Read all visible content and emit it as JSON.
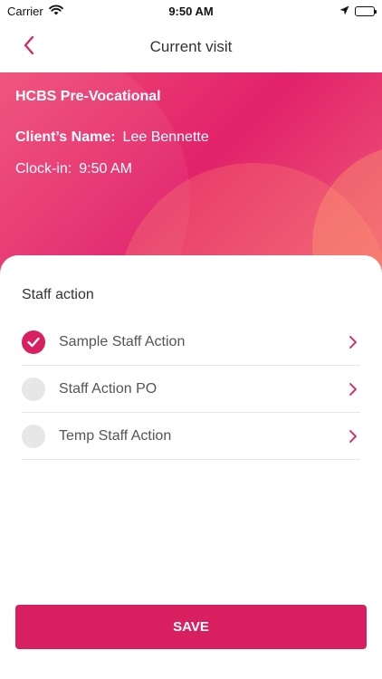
{
  "status_bar": {
    "carrier": "Carrier",
    "time": "9:50 AM",
    "icons": [
      "wifi-icon",
      "location-arrow-icon",
      "battery-icon"
    ]
  },
  "nav": {
    "title": "Current visit",
    "back_icon": "chevron-left-icon"
  },
  "visit": {
    "program": "HCBS Pre-Vocational",
    "client_label": "Client’s Name:",
    "client_name": "Lee Bennette",
    "clock_in_label": "Clock-in:",
    "clock_in_time": "9:50 AM"
  },
  "staff_action": {
    "title": "Staff action",
    "items": [
      {
        "label": "Sample Staff Action",
        "checked": true
      },
      {
        "label": "Staff Action PO",
        "checked": false
      },
      {
        "label": "Temp Staff Action",
        "checked": false
      }
    ]
  },
  "footer": {
    "save_label": "SAVE"
  },
  "colors": {
    "accent": "#d81f60",
    "hero_start": "#ef4c76",
    "hero_end": "#e2226a",
    "unchecked": "#e7e7e7"
  }
}
